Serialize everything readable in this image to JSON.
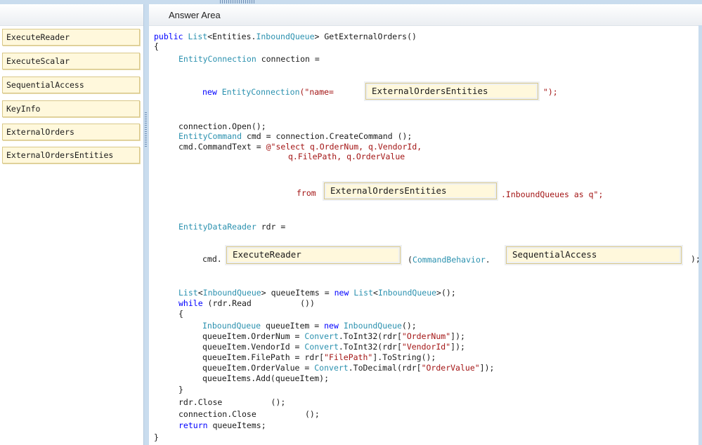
{
  "header": {
    "title": "Answer Area"
  },
  "drag_items": [
    "ExecuteReader",
    "ExecuteScalar",
    "SequentialAccess",
    "KeyInfo",
    "ExternalOrders",
    "ExternalOrdersEntities"
  ],
  "drop_targets": {
    "connection_name": "ExternalOrdersEntities",
    "from_source": "ExternalOrdersEntities",
    "execute_method": "ExecuteReader",
    "command_behavior": "SequentialAccess"
  },
  "code": {
    "l1_kw": "public",
    "l1_type1": "List",
    "l1_mid": "<Entities.",
    "l1_type2": "InboundQueue",
    "l1_rest": "> GetExternalOrders()",
    "brace_open": "{",
    "brace_close": "}",
    "l3_type": "EntityConnection",
    "l3_rest": " connection =",
    "l4_kw": "new",
    "l4_type": "EntityConnection",
    "l4_str1": "(\"name=",
    "l4_after": " \");",
    "l5": "connection.Open();",
    "l6_type": "EntityCommand",
    "l6_rest": " cmd = connection.CreateCommand ();",
    "l7_pre": "cmd.CommandText = ",
    "l7_str": "@\"select q.OrderNum, q.VendorId,",
    "l8_str": "q.FilePath, q.OrderValue",
    "l9_str1": "from",
    "l9_str2": ".InboundQueues as q\";",
    "l10_type": "EntityDataReader",
    "l10_rest": " rdr =",
    "l11_pre": "cmd.",
    "l11_mid_open": "(",
    "l11_mid_type": "CommandBehavior",
    "l11_mid_dot": ".",
    "l11_end": ");",
    "l12_type1": "List",
    "l12_a": "<",
    "l12_type2": "InboundQueue",
    "l12_b": "> queueItems = ",
    "l12_kw": "new",
    "l12_type3": "List",
    "l12_c": "<",
    "l12_type4": "InboundQueue",
    "l12_d": ">();",
    "l13_kw": "while",
    "l13_rest": " (rdr.Read          ())",
    "l14": "{",
    "l15_type1": "InboundQueue",
    "l15_a": " queueItem = ",
    "l15_kw": "new",
    "l15_type2": "InboundQueue",
    "l15_b": "();",
    "l16_a": "queueItem.OrderNum = ",
    "l16_type": "Convert",
    "l16_b": ".ToInt32(rdr[",
    "l16_str": "\"OrderNum\"",
    "l16_c": "]);",
    "l17_a": "queueItem.VendorId = ",
    "l17_type": "Convert",
    "l17_b": ".ToInt32(rdr[",
    "l17_str": "\"VendorId\"",
    "l17_c": "]);",
    "l18_a": "queueItem.FilePath = rdr[",
    "l18_str": "\"FilePath\"",
    "l18_b": "].ToString();",
    "l19_a": "queueItem.OrderValue = ",
    "l19_type": "Convert",
    "l19_b": ".ToDecimal(rdr[",
    "l19_str": "\"OrderValue\"",
    "l19_c": "]);",
    "l20": "queueItems.Add(queueItem);",
    "l21": "}",
    "l22": "rdr.Close          ();",
    "l23": "connection.Close          ();",
    "l24_kw": "return",
    "l24_rest": " queueItems;"
  }
}
